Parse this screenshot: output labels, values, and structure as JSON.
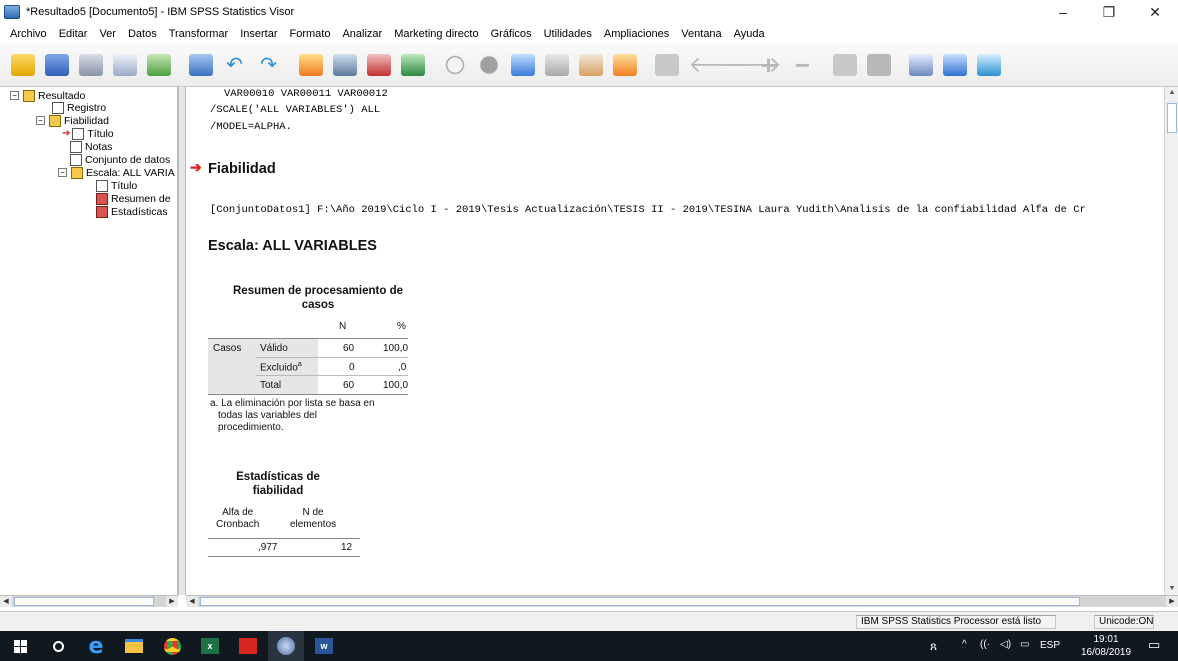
{
  "window": {
    "title": "*Resultado5 [Documento5] - IBM SPSS Statistics Visor",
    "minimize": "–",
    "maximize": "❐",
    "close": "✕"
  },
  "menu": [
    "Archivo",
    "Editar",
    "Ver",
    "Datos",
    "Transformar",
    "Insertar",
    "Formato",
    "Analizar",
    "Marketing directo",
    "Gráficos",
    "Utilidades",
    "Ampliaciones",
    "Ventana",
    "Ayuda"
  ],
  "toolbar_icons": [
    "open-icon",
    "save-icon",
    "print-icon",
    "print-preview-icon",
    "export-icon",
    "recall-dialog-icon",
    "undo-icon",
    "redo-icon",
    "goto-data-icon",
    "goto-case-icon",
    "goto-variable-icon",
    "variables-icon",
    "circle-light-icon",
    "circle-dark-icon",
    "insert-output-icon",
    "designate-window-icon",
    "insert-heading-icon",
    "insert-title-icon",
    "insert-text-icon",
    "back-icon",
    "forward-icon",
    "expand-icon",
    "collapse-icon",
    "show-icon",
    "hide-icon",
    "insert-page-title-icon",
    "insert-new-text-icon",
    "export-doc-icon"
  ],
  "outline": {
    "items": [
      {
        "label": "Resultado",
        "level": 0,
        "icon": "book-icon",
        "toggle": "⊟"
      },
      {
        "label": "Registro",
        "level": 1,
        "icon": "log-icon",
        "toggle": ""
      },
      {
        "label": "Fiabilidad",
        "level": 1,
        "icon": "book-icon",
        "toggle": "⊟"
      },
      {
        "label": "Título",
        "level": 2,
        "icon": "title-icon",
        "toggle": "",
        "current": true
      },
      {
        "label": "Notas",
        "level": 2,
        "icon": "notes-icon",
        "toggle": ""
      },
      {
        "label": "Conjunto de datos",
        "level": 2,
        "icon": "dataset-icon",
        "toggle": ""
      },
      {
        "label": "Escala: ALL VARIA",
        "level": 2,
        "icon": "book-icon",
        "toggle": "⊟"
      },
      {
        "label": "Título",
        "level": 3,
        "icon": "title-icon",
        "toggle": ""
      },
      {
        "label": "Resumen de",
        "level": 3,
        "icon": "table-icon",
        "toggle": ""
      },
      {
        "label": "Estadísticas",
        "level": 3,
        "icon": "table-icon",
        "toggle": ""
      }
    ]
  },
  "syntax": {
    "line1": "VAR00010 VAR00011 VAR00012",
    "line2": "/SCALE('ALL VARIABLES') ALL",
    "line3": "/MODEL=ALPHA."
  },
  "content": {
    "heading": "Fiabilidad",
    "dataset_line": "[ConjuntoDatos1] F:\\Año 2019\\Ciclo I - 2019\\Tesis Actualización\\TESIS II - 2019\\TESINA Laura Yudith\\Analisis de la confiabilidad Alfa de Cr",
    "scale_title": "Escala: ALL VARIABLES"
  },
  "case_summary": {
    "title_line1": "Resumen de procesamiento de",
    "title_line2": "casos",
    "col_n": "N",
    "col_pct": "%",
    "row_group": "Casos",
    "rows": [
      {
        "label": "Válido",
        "n": "60",
        "pct": "100,0"
      },
      {
        "label": "Excluido",
        "sup": "a",
        "n": "0",
        "pct": ",0"
      },
      {
        "label": "Total",
        "n": "60",
        "pct": "100,0"
      }
    ],
    "footnote_line1": "a. La eliminación por lista se basa en",
    "footnote_line2": "todas las variables del",
    "footnote_line3": "procedimiento."
  },
  "reliability": {
    "title_line1": "Estadísticas de",
    "title_line2": "fiabilidad",
    "col1_line1": "Alfa de",
    "col1_line2": "Cronbach",
    "col2_line1": "N de",
    "col2_line2": "elementos",
    "alpha": ",977",
    "n_items": "12"
  },
  "status": {
    "processor": "IBM SPSS Statistics Processor está listo",
    "unicode": "Unicode:ON"
  },
  "taskbar": {
    "apps": [
      "windows-start-icon",
      "search-icon",
      "edge-icon",
      "file-explorer-icon",
      "chrome-icon",
      "excel-icon",
      "acrobat-icon",
      "spss-icon",
      "word-icon"
    ],
    "language": "ESP",
    "time": "19:01",
    "date": "16/08/2019"
  }
}
